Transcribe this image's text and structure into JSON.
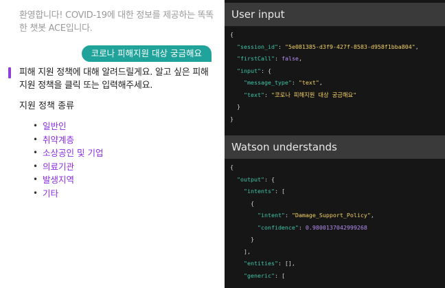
{
  "chat": {
    "greeting": "환영합니다! COVID-19에 대한 정보를 제공하는 똑똑한 챗봇 ACE입니다.",
    "user_message": "코로나 피해지원 대상 궁금해요",
    "bot_message": "피해 지원 정책에 대해 알려드릴게요. 알고 싶은 피해 지원 정책을 클릭 또는 입력해주세요.",
    "policy_heading": "지원 정책 종류",
    "policy_options": [
      "일반인",
      "취약계층",
      "소상공인 및 기업",
      "의료기관",
      "발생지역",
      "기타"
    ]
  },
  "user_input_panel": {
    "title": "User input",
    "session_id_key": "\"session_id\"",
    "session_id_value": "\"5e081385-d3f9-427f-8583-d958f1bba804\"",
    "first_call_key": "\"firstCall\"",
    "first_call_value": "false",
    "input_key": "\"input\"",
    "message_type_key": "\"message_type\"",
    "message_type_value": "\"text\"",
    "text_key": "\"text\"",
    "text_value": "\"코로나 피해지원 대상 궁금해요\""
  },
  "watson_panel": {
    "title": "Watson understands",
    "output_key": "\"output\"",
    "intents_key": "\"intents\"",
    "intent_key": "\"intent\"",
    "intent_value": "\"Damage_Support_Policy\"",
    "confidence_key": "\"confidence\"",
    "confidence_value": "0.9800137042999268",
    "entities_key": "\"entities\"",
    "generic_key": "\"generic\""
  },
  "colors": {
    "accent_teal": "#1fa39b",
    "accent_purple": "#8a2be2",
    "json_key": "#40c6a8",
    "json_string": "#f4d264",
    "json_number": "#b48cf2",
    "panel_bg": "#161616",
    "panel_header_bg": "#3a3a3a"
  }
}
